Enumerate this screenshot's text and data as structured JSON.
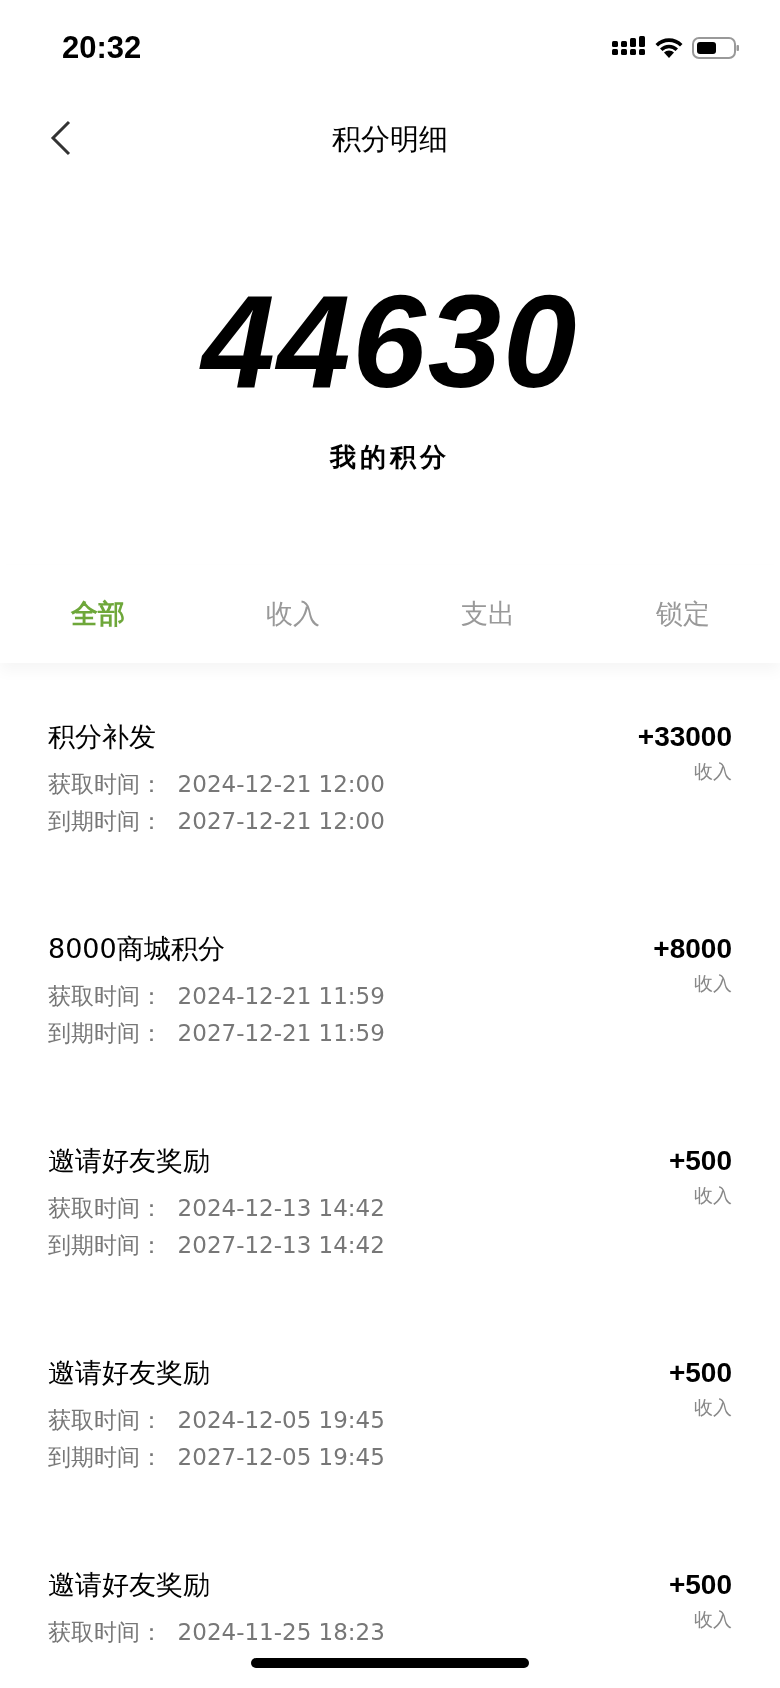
{
  "status_bar": {
    "time": "20:32"
  },
  "nav": {
    "title": "积分明细"
  },
  "summary": {
    "points": "44630",
    "label": "我的积分"
  },
  "tabs": [
    {
      "label": "全部",
      "selected": true
    },
    {
      "label": "收入",
      "selected": false
    },
    {
      "label": "支出",
      "selected": false
    },
    {
      "label": "锁定",
      "selected": false
    }
  ],
  "records": [
    {
      "title": "积分补发",
      "amount": "+33000",
      "type": "收入",
      "acquired": "获取时间：  2024-12-21 12:00",
      "expires": "到期时间：  2027-12-21 12:00"
    },
    {
      "title": "8000商城积分",
      "amount": "+8000",
      "type": "收入",
      "acquired": "获取时间：  2024-12-21 11:59",
      "expires": "到期时间：  2027-12-21 11:59"
    },
    {
      "title": "邀请好友奖励",
      "amount": "+500",
      "type": "收入",
      "acquired": "获取时间：  2024-12-13 14:42",
      "expires": "到期时间：  2027-12-13 14:42"
    },
    {
      "title": "邀请好友奖励",
      "amount": "+500",
      "type": "收入",
      "acquired": "获取时间：  2024-12-05 19:45",
      "expires": "到期时间：  2027-12-05 19:45"
    },
    {
      "title": "邀请好友奖励",
      "amount": "+500",
      "type": "收入",
      "acquired": "获取时间：  2024-11-25 18:23"
    }
  ]
}
